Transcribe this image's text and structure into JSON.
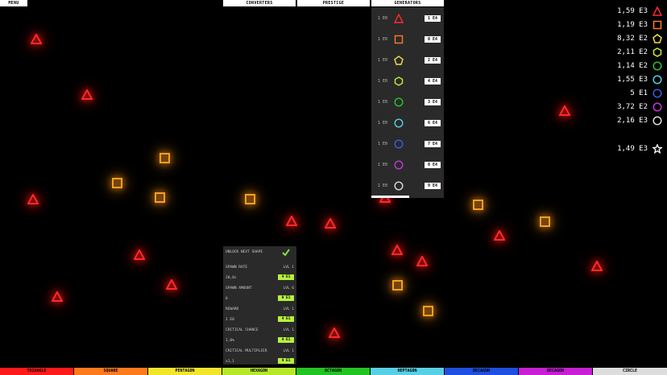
{
  "top_tabs": {
    "menu": "MENU",
    "converters": "CONVERTERS",
    "prestige": "PRESTIGE",
    "generators": "GENERATORS"
  },
  "generators": [
    {
      "cost": "1 E0",
      "shape": "triangle",
      "color": "#ff2a2a",
      "button": "1 E4"
    },
    {
      "cost": "1 E0",
      "shape": "square",
      "color": "#ff7a2a",
      "button": "8 E4"
    },
    {
      "cost": "1 E0",
      "shape": "pentagon",
      "color": "#f2e04a",
      "button": "2 E4"
    },
    {
      "cost": "1 E0",
      "shape": "hexagon",
      "color": "#c8ea3a",
      "button": "4 E4"
    },
    {
      "cost": "1 E0",
      "shape": "circle",
      "color": "#2bc62b",
      "button": "3 E4"
    },
    {
      "cost": "1 E0",
      "shape": "circle",
      "color": "#57d0e6",
      "button": "6 E4"
    },
    {
      "cost": "1 E0",
      "shape": "circle",
      "color": "#3a5fe0",
      "button": "7 E4"
    },
    {
      "cost": "1 E0",
      "shape": "circle",
      "color": "#c23ad6",
      "button": "8 E4"
    },
    {
      "cost": "1 E0",
      "shape": "circle",
      "color": "#dddddd",
      "button": "9 E4"
    }
  ],
  "resources": [
    {
      "value": "1,59 E3",
      "shape": "triangle",
      "color": "#ff2a2a"
    },
    {
      "value": "1,19 E3",
      "shape": "square",
      "color": "#ff7a2a"
    },
    {
      "value": "8,32 E2",
      "shape": "pentagon",
      "color": "#f2e04a"
    },
    {
      "value": "2,11 E2",
      "shape": "hexagon",
      "color": "#c8ea3a"
    },
    {
      "value": "1,14 E2",
      "shape": "circle",
      "color": "#2bc62b"
    },
    {
      "value": "1,55 E3",
      "shape": "circle",
      "color": "#57d0e6"
    },
    {
      "value": "5 E1",
      "shape": "circle",
      "color": "#3a5fe0"
    },
    {
      "value": "3,72 E2",
      "shape": "circle",
      "color": "#c23ad6"
    },
    {
      "value": "2,16 E3",
      "shape": "circle",
      "color": "#dddddd"
    }
  ],
  "star_resource": {
    "value": "1,49 E3",
    "icon": "star-icon"
  },
  "upgrades": {
    "unlock_label": "UNLOCK NEXT SHAPE",
    "spawn_rate": {
      "label": "SPAWN RATE",
      "level": "LVL 1",
      "value": "20,0s",
      "button": "4 E1"
    },
    "spawn_amount": {
      "label": "SPAWN AMOUNT",
      "level": "LVL 6",
      "value": "6",
      "button": "9 E1"
    },
    "reward": {
      "label": "REWARD",
      "level": "LVL 1",
      "value": "1 E0",
      "button": "4 E1"
    },
    "critical_chance": {
      "label": "CRITICAL CHANCE",
      "level": "LVL 1",
      "value": "1,0%",
      "button": "4 E1"
    },
    "critical_multiplier": {
      "label": "CRITICAL MULTIPLIER",
      "level": "LVL 1",
      "value": "x1,1",
      "button": "4 E1"
    }
  },
  "bottom_tabs": [
    {
      "label": "TRIANGLE",
      "color": "#ff1a1a"
    },
    {
      "label": "SQUARE",
      "color": "#ff7a1a"
    },
    {
      "label": "PENTAGON",
      "color": "#f2e52a"
    },
    {
      "label": "HEXAGON",
      "color": "#b6e82a"
    },
    {
      "label": "OCTAGON",
      "color": "#22c422"
    },
    {
      "label": "HEPTAGON",
      "color": "#57d0e6"
    },
    {
      "label": "DECAGON",
      "color": "#1f4fe0"
    },
    {
      "label": "DECAGON",
      "color": "#c81ed6"
    },
    {
      "label": "CIRCLE",
      "color": "#dddddd"
    }
  ]
}
